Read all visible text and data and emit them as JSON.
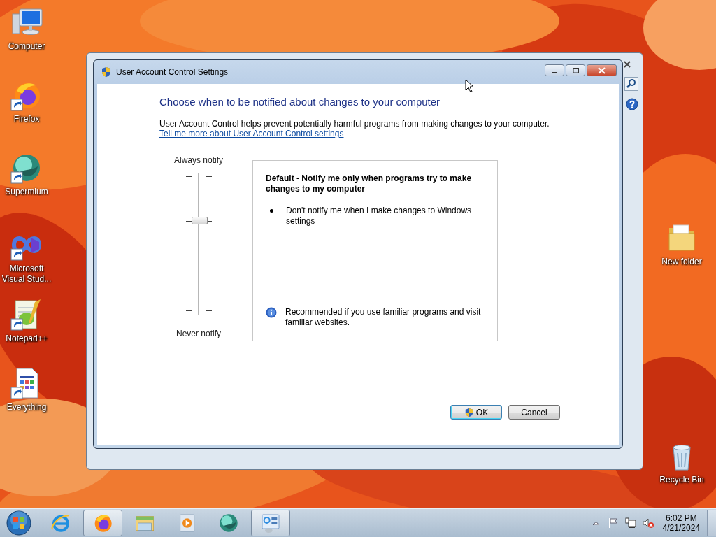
{
  "desktop": {
    "icons": [
      {
        "label": "Computer",
        "kind": "computer",
        "shortcut": false
      },
      {
        "label": "Firefox",
        "kind": "firefox",
        "shortcut": true
      },
      {
        "label": "Supermium",
        "kind": "supermium",
        "shortcut": true
      },
      {
        "label": "Microsoft Visual Stud...",
        "kind": "visualstudio",
        "shortcut": true
      },
      {
        "label": "Notepad++",
        "kind": "notepad",
        "shortcut": true
      },
      {
        "label": "Everything",
        "kind": "everything",
        "shortcut": true
      },
      {
        "label": "New folder",
        "kind": "folder",
        "shortcut": false
      },
      {
        "label": "Recycle Bin",
        "kind": "recycle",
        "shortcut": false
      }
    ]
  },
  "dialog": {
    "title": "User Account Control Settings",
    "heading": "Choose when to be notified about changes to your computer",
    "description": "User Account Control helps prevent potentially harmful programs from making changes to your computer.",
    "link": "Tell me more about User Account Control settings",
    "slider": {
      "top_label": "Always notify",
      "bottom_label": "Never notify",
      "level": 0.67
    },
    "info": {
      "title": "Default - Notify me only when programs try to make changes to my computer",
      "bullets": [
        "Don't notify me when I make changes to Windows settings"
      ],
      "note": "Recommended if you use familiar programs and visit familiar websites."
    },
    "buttons": [
      {
        "label": "OK",
        "shield": true,
        "default": true
      },
      {
        "label": "Cancel",
        "shield": false,
        "default": false
      }
    ]
  },
  "taskbar": {
    "items": [
      {
        "kind": "ie",
        "open": false
      },
      {
        "kind": "firefox",
        "open": true
      },
      {
        "kind": "explorer",
        "open": false
      },
      {
        "kind": "media",
        "open": false
      },
      {
        "kind": "supermium",
        "open": false
      },
      {
        "kind": "controlpanel",
        "open": true
      }
    ],
    "clock": {
      "time": "6:02 PM",
      "date": "4/21/2024"
    }
  }
}
